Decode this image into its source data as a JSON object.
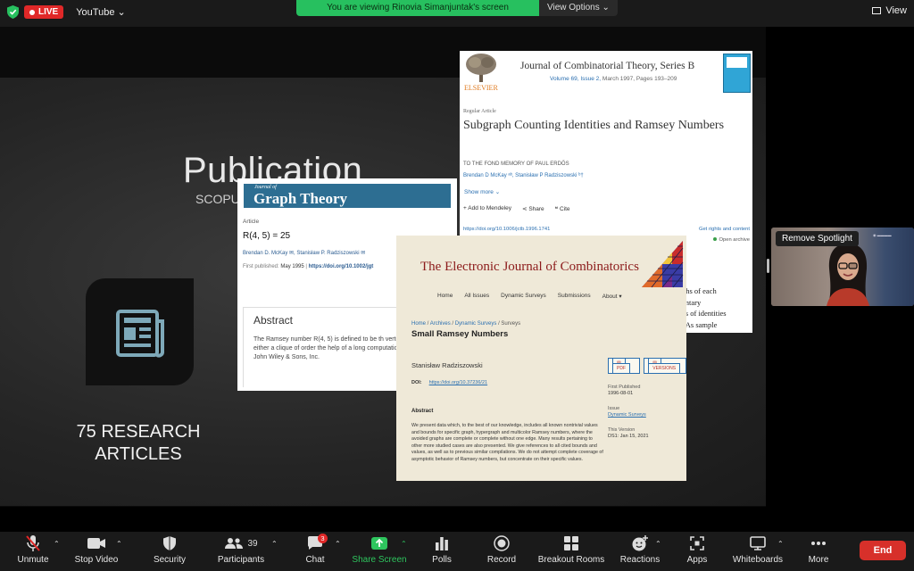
{
  "topbar": {
    "live_label": "LIVE",
    "platform_label": "YouTube",
    "viewing_banner": "You are viewing Rinovia Simanjuntak's screen",
    "view_options_label": "View Options",
    "view_label": "View"
  },
  "slide": {
    "title": "Publication",
    "subtitle": "SCOPUS, 25 August 2022",
    "articles_line1": "75 RESEARCH",
    "articles_line2": "ARTICLES"
  },
  "card_jgt": {
    "journal_small": "Journal of",
    "journal_big": "Graph Theory",
    "article_label": "Article",
    "title": "R(4, 5) = 25",
    "authors": "Brendan D. McKay ✉, Stanisław P. Radziszowski ✉",
    "first_published_label": "First published:",
    "first_published_value": "May 1995",
    "doi": "https://doi.org/10.1002/jgt",
    "abstract_title": "Abstract",
    "abstract_text": "The Ramsey number R(4, 5) is defined to be th vertex graph contains either a clique of order the help of a long computation using novel tec John Wiley & Sons, Inc."
  },
  "card_jct": {
    "publisher": "ELSEVIER",
    "journal": "Journal of Combinatorial Theory, Series B",
    "volume": "Volume 69, Issue 2,",
    "date_pages": " March 1997, Pages 193–209",
    "article_type": "Regular Article",
    "title": "Subgraph Counting Identities and Ramsey Numbers",
    "dedication": "TO THE FOND MEMORY OF PAUL ERDŐS",
    "authors": "Brendan D McKay ᵃᵇ, Stanisław P Radziszowski ᵇ†",
    "show_more": "Show more",
    "add_mendeley": "Add to Mendeley",
    "share": "Share",
    "cite": "Cite",
    "doi": "https://doi.org/10.1006/jctb.1996.1741",
    "rights": "Get rights and content",
    "open_archive": "Open archive",
    "body_line1": "phs of each",
    "body_line2": "entary",
    "body_line3": "es of identities",
    "body_line4": ". As sample"
  },
  "card_ejc": {
    "journal": "The Electronic Journal of Combinatorics",
    "nav": [
      "Home",
      "All Issues",
      "Dynamic Surveys",
      "Submissions",
      "About ▾"
    ],
    "crumb_home": "Home",
    "crumb_archives": "Archives",
    "crumb_dynamic": "Dynamic Surveys",
    "crumb_current": "Surveys",
    "title": "Small Ramsey Numbers",
    "author": "Stanisław Radziszowski",
    "pdf_btn": "PDF",
    "versions_btn": "VERSIONS",
    "doi_label": "DOI:",
    "doi": "https://doi.org/10.37236/21",
    "first_published_label": "First Published",
    "first_published_value": "1996-08-01",
    "issue_label": "Issue",
    "issue_value": "Dynamic Surveys",
    "this_version_label": "This Version",
    "this_version_value": "DS1: Jan 15, 2021",
    "abstract_label": "Abstract",
    "abstract_text": "We present data which, to the best of our knowledge, includes all known nontrivial values and bounds for specific graph, hypergraph and multicolor Ramsey numbers, where the avoided graphs are complete or complete without one edge. Many results pertaining to other more studied cases are also presented. We give references to all cited bounds and values, as well as to previous similar compilations. We do not attempt complete coverage of asymptotic behavior of Ramsey numbers, but concentrate on their specific values."
  },
  "video": {
    "spotlight_label": "Remove Spotlight"
  },
  "toolbar": {
    "unmute": "Unmute",
    "stop_video": "Stop Video",
    "security": "Security",
    "participants": "Participants",
    "participants_count": "39",
    "chat": "Chat",
    "chat_badge": "3",
    "share_screen": "Share Screen",
    "polls": "Polls",
    "record": "Record",
    "breakout": "Breakout Rooms",
    "reactions": "Reactions",
    "apps": "Apps",
    "whiteboards": "Whiteboards",
    "more": "More",
    "end": "End"
  },
  "colors": {
    "live_red": "#e02828",
    "banner_green": "#27c05f",
    "share_green": "#2ec55e",
    "end_red": "#d7302a",
    "jgt_blue": "#2d6e92",
    "ejc_red": "#8c1b1b"
  }
}
